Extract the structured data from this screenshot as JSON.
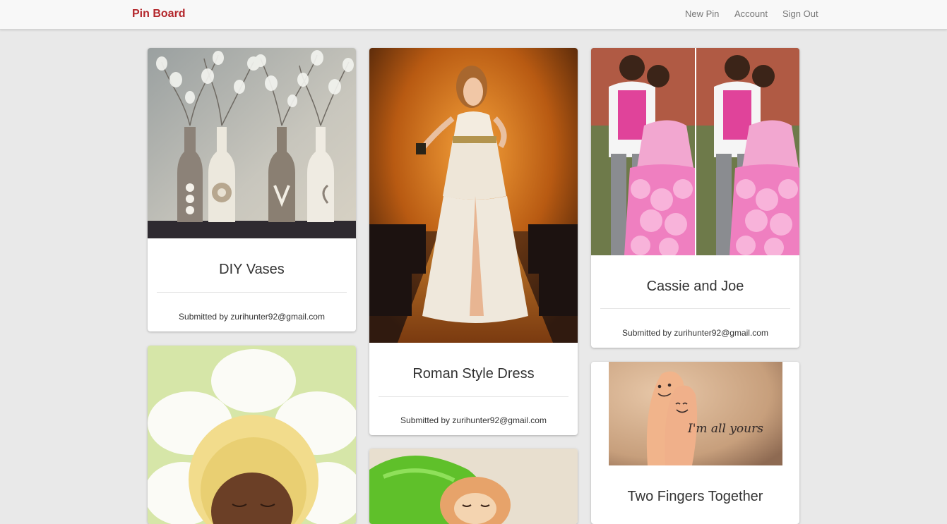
{
  "navbar": {
    "brand": "Pin Board",
    "links": [
      "New Pin",
      "Account",
      "Sign Out"
    ]
  },
  "submitted_prefix": "Submitted by",
  "pins": [
    {
      "title": "DIY Vases",
      "email": "zurihunter92@gmail.com",
      "image": "vases-photo"
    },
    {
      "title": "Roman Style Dress",
      "email": "zurihunter92@gmail.com",
      "image": "dress-photo"
    },
    {
      "title": "Cassie and Joe",
      "email": "zurihunter92@gmail.com",
      "image": "couple-photo"
    },
    {
      "title": "Two Fingers Together",
      "email": "",
      "image": "fingers-photo",
      "image_text": "I'm all yours"
    },
    {
      "title": "",
      "email": "",
      "image": "baby-photo"
    },
    {
      "title": "",
      "email": "",
      "image": "kitten-photo"
    }
  ],
  "colors": {
    "brand": "#b3262b",
    "background": "#e9e9e9",
    "card": "#ffffff"
  }
}
